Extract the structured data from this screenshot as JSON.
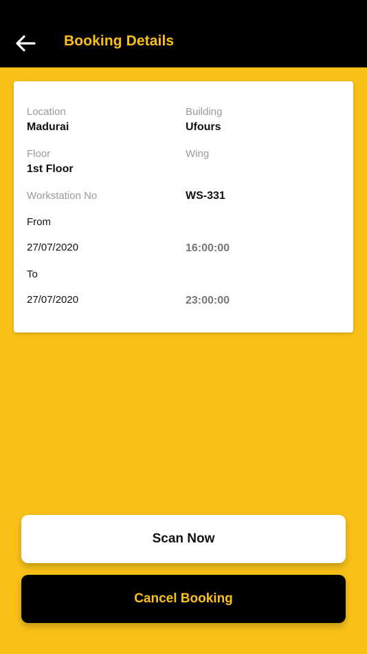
{
  "header": {
    "title": "Booking Details",
    "back_icon": "arrow-left-icon"
  },
  "details": {
    "location_label": "Location",
    "location_value": "Madurai",
    "building_label": "Building",
    "building_value": "Ufours",
    "floor_label": "Floor",
    "floor_value": "1st Floor",
    "wing_label": "Wing",
    "workstation_label": "Workstation No",
    "workstation_value": "WS-331",
    "from_label": "From",
    "from_date": "27/07/2020",
    "from_time": "16:00:00",
    "to_label": "To",
    "to_date": "27/07/2020",
    "to_time": "23:00:00"
  },
  "actions": {
    "scan_label": "Scan Now",
    "cancel_label": "Cancel Booking"
  },
  "colors": {
    "accent": "#F9C118",
    "app_bar": "#000000",
    "card": "#FFFFFF"
  }
}
